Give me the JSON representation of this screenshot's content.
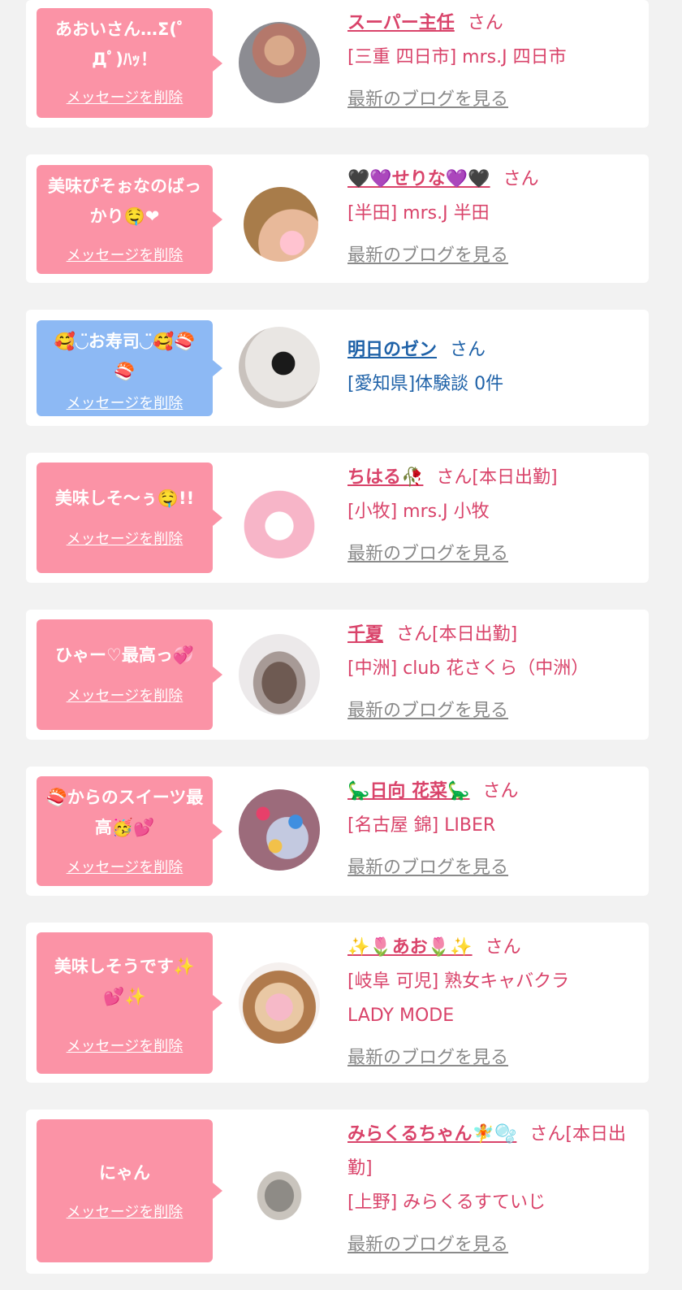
{
  "colors": {
    "pink": "#fb93a6",
    "blue": "#8db9f4",
    "name_pink": "#d9436a",
    "name_blue": "#1f62a8",
    "link_gray": "#8a8a8a",
    "background": "#f2f2f2"
  },
  "delete_label": "メッセージを削除",
  "blog_label": "最新のブログを見る",
  "cards": [
    {
      "message": "あおいさん…Σ(゜Дﾟ)ﾊｯ！",
      "name": "スーパー主任",
      "suffix": "さん",
      "shop": "[三重 四日市] mrs.J 四日市",
      "blog": "最新のブログを見る",
      "theme": "pink",
      "avatar": "person-icon"
    },
    {
      "message": "美味ぴそぉなのばっかり🤤❤",
      "name": "🖤💜せりな💜🖤",
      "suffix": "さん",
      "shop": "[半田] mrs.J 半田",
      "blog": "最新のブログを見る",
      "theme": "pink",
      "avatar": "person-icon"
    },
    {
      "message": "🥰◡̈お寿司◡̈🥰🍣🍣",
      "name": "明日のゼン",
      "suffix": "さん",
      "shop": "[愛知県]体験談 0件",
      "blog": "",
      "theme": "blue",
      "avatar": "penguin-icon"
    },
    {
      "message": "美味しそ〜ぅ🤤!!",
      "name": "ちはる🥀",
      "suffix": "さん[本日出勤]",
      "shop": "[小牧] mrs.J 小牧",
      "blog": "最新のブログを見る",
      "theme": "pink",
      "avatar": "plush-icon"
    },
    {
      "message": "ひゃー♡最高っ💞",
      "name": "千夏",
      "suffix": "さん[本日出勤]",
      "shop": "[中洲] club 花さくら（中洲）",
      "blog": "最新のブログを見る",
      "theme": "pink",
      "avatar": "hair-icon"
    },
    {
      "message": "🍣からのスイーツ最高🥳💕",
      "name": "🦕日向 花菜🦕",
      "suffix": "さん",
      "shop": "[名古屋 錦] LIBER",
      "blog": "最新のブログを見る",
      "theme": "pink",
      "avatar": "balls-icon"
    },
    {
      "message": "美味しそうです✨💕✨",
      "name": "✨🌷あお🌷✨",
      "suffix": "さん",
      "shop": "[岐阜 可児] 熟女キャバクラLADY MODE",
      "blog": "最新のブログを見る",
      "theme": "pink",
      "avatar": "person-icon"
    },
    {
      "message": "にゃん",
      "name": "みらくるちゃん🧚🫧",
      "suffix": "さん[本日出勤]",
      "shop": "[上野] みらくるすていじ",
      "blog": "最新のブログを見る",
      "theme": "pink",
      "avatar": "cat-icon"
    }
  ]
}
